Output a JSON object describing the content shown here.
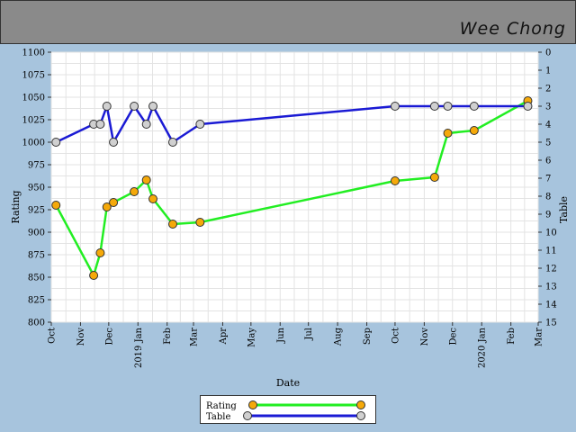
{
  "header": {
    "name": "Wee Chong"
  },
  "colors": {
    "rating_line": "#22ee22",
    "rating_marker": "#f5a90a",
    "table_line": "#1a1ad4",
    "table_marker": "#d0d0d0"
  },
  "chart_data": {
    "type": "line",
    "xlabel": "Date",
    "ylabel_left": "Rating",
    "ylabel_right": "Table",
    "x_range": [
      "2018-10-01",
      "2020-03-01"
    ],
    "y_left_range": [
      800,
      1100
    ],
    "y_left_ticks": [
      800,
      825,
      850,
      875,
      900,
      925,
      950,
      975,
      1000,
      1025,
      1050,
      1075,
      1100
    ],
    "y_right_range": [
      0,
      15
    ],
    "y_right_inverted": true,
    "y_right_ticks": [
      0,
      1,
      2,
      3,
      4,
      5,
      6,
      7,
      8,
      9,
      10,
      11,
      12,
      13,
      14,
      15
    ],
    "x_ticks": [
      {
        "date": "2018-10-01",
        "label": "Oct"
      },
      {
        "date": "2018-11-01",
        "label": "Nov"
      },
      {
        "date": "2018-12-01",
        "label": "Dec"
      },
      {
        "date": "2019-01-01",
        "label": "2019 Jan"
      },
      {
        "date": "2019-02-01",
        "label": "Feb"
      },
      {
        "date": "2019-03-01",
        "label": "Mar"
      },
      {
        "date": "2019-04-01",
        "label": "Apr"
      },
      {
        "date": "2019-05-01",
        "label": "May"
      },
      {
        "date": "2019-06-01",
        "label": "Jun"
      },
      {
        "date": "2019-07-01",
        "label": "Jul"
      },
      {
        "date": "2019-08-01",
        "label": "Aug"
      },
      {
        "date": "2019-09-01",
        "label": "Sep"
      },
      {
        "date": "2019-10-01",
        "label": "Oct"
      },
      {
        "date": "2019-11-01",
        "label": "Nov"
      },
      {
        "date": "2019-12-01",
        "label": "Dec"
      },
      {
        "date": "2020-01-01",
        "label": "2020 Jan"
      },
      {
        "date": "2020-02-01",
        "label": "Feb"
      },
      {
        "date": "2020-03-01",
        "label": "Mar"
      }
    ],
    "grid": true,
    "legend_position": "bottom-center",
    "series": [
      {
        "name": "Rating",
        "axis": "left",
        "points": [
          [
            "2018-10-06",
            930
          ],
          [
            "2018-11-15",
            852
          ],
          [
            "2018-11-22",
            877
          ],
          [
            "2018-11-29",
            928
          ],
          [
            "2018-12-06",
            933
          ],
          [
            "2018-12-28",
            945
          ],
          [
            "2019-01-10",
            958
          ],
          [
            "2019-01-17",
            937
          ],
          [
            "2019-02-07",
            909
          ],
          [
            "2019-03-08",
            911
          ],
          [
            "2019-10-01",
            957
          ],
          [
            "2019-11-12",
            961
          ],
          [
            "2019-11-26",
            1010
          ],
          [
            "2019-12-24",
            1013
          ],
          [
            "2020-02-19",
            1046
          ]
        ]
      },
      {
        "name": "Table",
        "axis": "right",
        "points": [
          [
            "2018-10-06",
            5
          ],
          [
            "2018-11-15",
            4
          ],
          [
            "2018-11-22",
            4
          ],
          [
            "2018-11-29",
            3
          ],
          [
            "2018-12-06",
            5
          ],
          [
            "2018-12-28",
            3
          ],
          [
            "2019-01-10",
            4
          ],
          [
            "2019-01-17",
            3
          ],
          [
            "2019-02-07",
            5
          ],
          [
            "2019-03-08",
            4
          ],
          [
            "2019-10-01",
            3
          ],
          [
            "2019-11-12",
            3
          ],
          [
            "2019-11-26",
            3
          ],
          [
            "2019-12-24",
            3
          ],
          [
            "2020-02-19",
            3
          ]
        ]
      }
    ]
  }
}
